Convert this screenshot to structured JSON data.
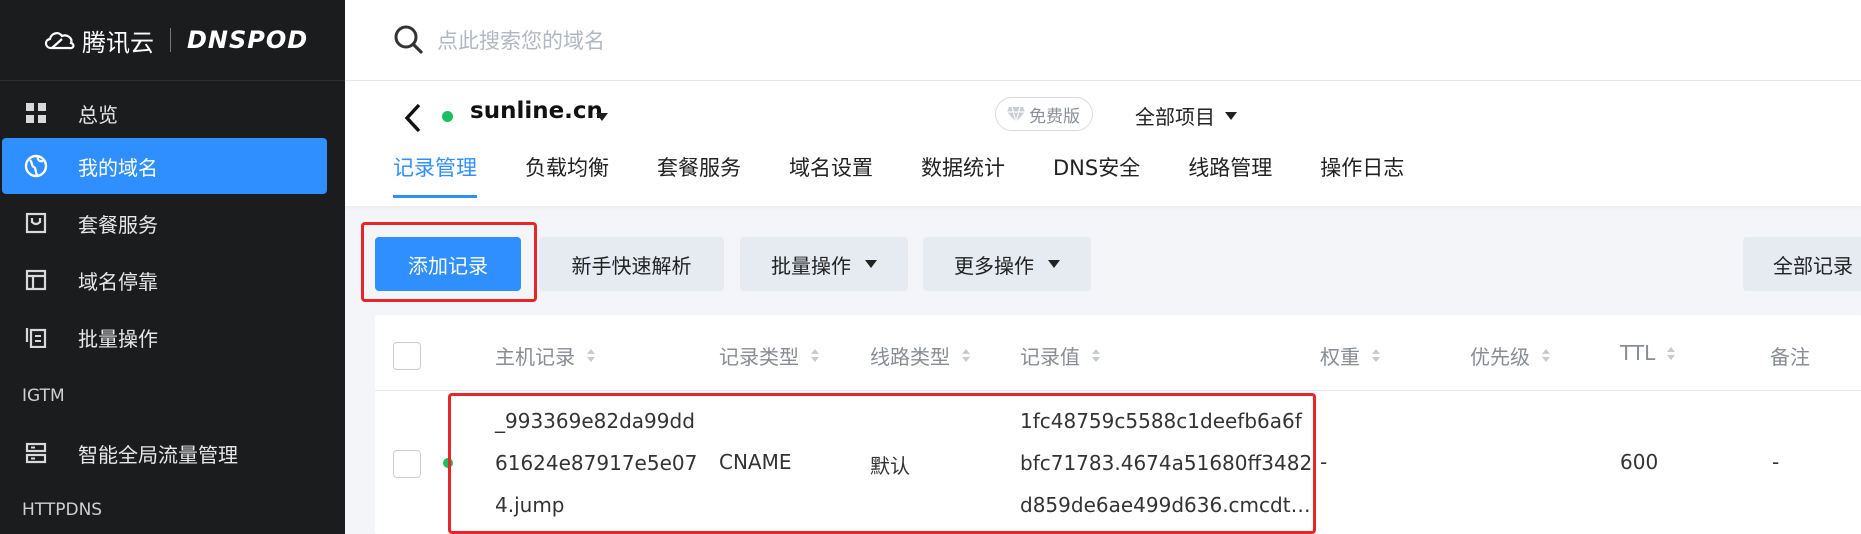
{
  "sidebar": {
    "brand_left": "腾讯云",
    "brand_right": "DNSPOD",
    "items": [
      {
        "label": "总览",
        "icon": "grid-icon"
      },
      {
        "label": "我的域名",
        "icon": "globe-icon",
        "active": true
      },
      {
        "label": "套餐服务",
        "icon": "package-icon"
      },
      {
        "label": "域名停靠",
        "icon": "browser-window-icon"
      },
      {
        "label": "批量操作",
        "icon": "copy-stack-icon"
      }
    ],
    "section_igtm": "IGTM",
    "igtm_item": {
      "label": "智能全局流量管理",
      "icon": "server-list-icon"
    },
    "section_httpdns": "HTTPDNS"
  },
  "search": {
    "placeholder": "点此搜索您的域名"
  },
  "header": {
    "domain": "sunline.cn",
    "plan_badge": "免费版",
    "project_select": "全部项目",
    "tabs": [
      "记录管理",
      "负载均衡",
      "套餐服务",
      "域名设置",
      "数据统计",
      "DNS安全",
      "线路管理",
      "操作日志"
    ]
  },
  "toolbar": {
    "add_record": "添加记录",
    "quick_resolve": "新手快速解析",
    "batch_ops": "批量操作",
    "more_ops": "更多操作",
    "all_records": "全部记录"
  },
  "table": {
    "columns": [
      "主机记录",
      "记录类型",
      "线路类型",
      "记录值",
      "权重",
      "优先级",
      "TTL",
      "备注"
    ],
    "rows": [
      {
        "host_lines": [
          "_993369e82da99dd",
          "61624e87917e5e07",
          "4.jump"
        ],
        "type": "CNAME",
        "line": "默认",
        "value_lines": [
          "1fc48759c5588c1deefb6a6f",
          "bfc71783.4674a51680ff3482",
          "d859de6ae499d636.cmcdt…"
        ],
        "weight": "-",
        "priority": "",
        "ttl": "600",
        "remark": "-"
      }
    ]
  },
  "colors": {
    "accent": "#2f8fff",
    "highlight": "#e8262a",
    "status": "#18c060",
    "sidebar": "#1b1c1e"
  }
}
